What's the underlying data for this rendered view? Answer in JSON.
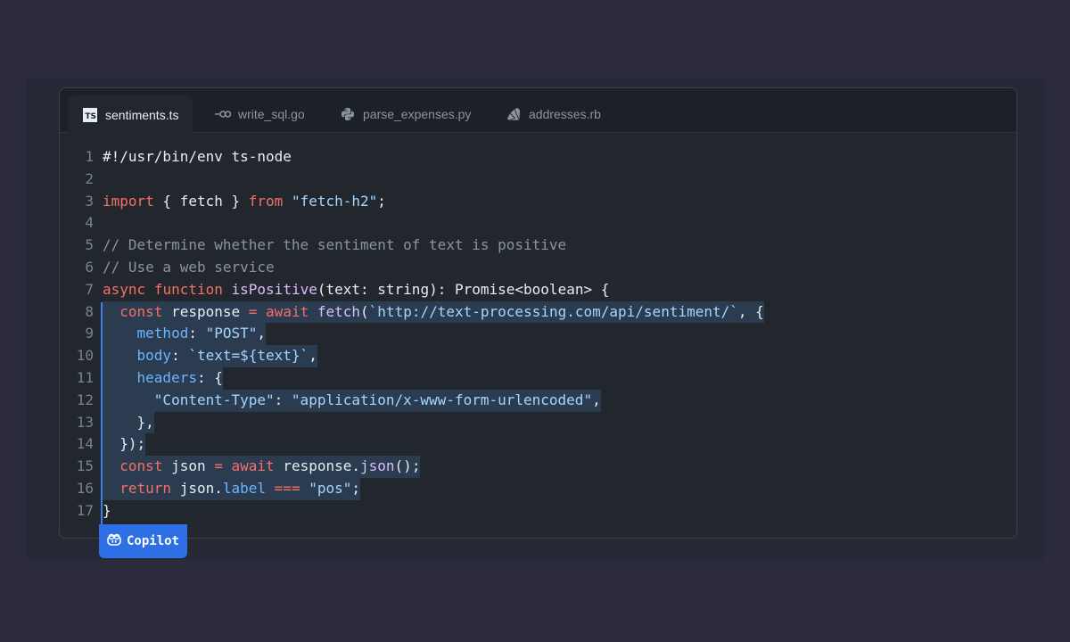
{
  "tabs": [
    {
      "label": "sentiments.ts",
      "icon": "typescript-icon",
      "active": true
    },
    {
      "label": "write_sql.go",
      "icon": "go-icon",
      "active": false
    },
    {
      "label": "parse_expenses.py",
      "icon": "python-icon",
      "active": false
    },
    {
      "label": "addresses.rb",
      "icon": "ruby-icon",
      "active": false
    }
  ],
  "ts_icon_text": "TS",
  "code_lines": [
    {
      "n": "1",
      "tokens": [
        [
          "t",
          "#!/usr/bin/env ts-node"
        ]
      ]
    },
    {
      "n": "2",
      "tokens": []
    },
    {
      "n": "3",
      "tokens": [
        [
          "kw",
          "import"
        ],
        [
          "t",
          " { fetch } "
        ],
        [
          "kw",
          "from"
        ],
        [
          "t",
          " "
        ],
        [
          "str",
          "\"fetch-h2\""
        ],
        [
          "t",
          ";"
        ]
      ]
    },
    {
      "n": "4",
      "tokens": []
    },
    {
      "n": "5",
      "tokens": [
        [
          "cm",
          "// Determine whether the sentiment of text is positive"
        ]
      ]
    },
    {
      "n": "6",
      "tokens": [
        [
          "cm",
          "// Use a web service"
        ]
      ]
    },
    {
      "n": "7",
      "tokens": [
        [
          "kw",
          "async"
        ],
        [
          "t",
          " "
        ],
        [
          "kw",
          "function"
        ],
        [
          "t",
          " "
        ],
        [
          "fn",
          "isPositive"
        ],
        [
          "t",
          "(text: string): Promise<boolean> {"
        ]
      ]
    },
    {
      "n": "8",
      "hl": true,
      "tokens": [
        [
          "t",
          "  "
        ],
        [
          "kw",
          "const"
        ],
        [
          "t",
          " response "
        ],
        [
          "op",
          "="
        ],
        [
          "t",
          " "
        ],
        [
          "kw",
          "await"
        ],
        [
          "t",
          " "
        ],
        [
          "fn",
          "fetch"
        ],
        [
          "t",
          "("
        ],
        [
          "str",
          "`http://text-processing.com/api/sentiment/`"
        ],
        [
          "t",
          ", {"
        ]
      ]
    },
    {
      "n": "9",
      "hl": true,
      "tokens": [
        [
          "t",
          "    "
        ],
        [
          "prop",
          "method"
        ],
        [
          "t",
          ": "
        ],
        [
          "str",
          "\"POST\""
        ],
        [
          "t",
          ","
        ]
      ]
    },
    {
      "n": "10",
      "hl": true,
      "tokens": [
        [
          "t",
          "    "
        ],
        [
          "prop",
          "body"
        ],
        [
          "t",
          ": "
        ],
        [
          "str",
          "`text=${text}`"
        ],
        [
          "t",
          ","
        ]
      ]
    },
    {
      "n": "11",
      "hl": true,
      "tokens": [
        [
          "t",
          "    "
        ],
        [
          "prop",
          "headers"
        ],
        [
          "t",
          ": {"
        ]
      ]
    },
    {
      "n": "12",
      "hl": true,
      "tokens": [
        [
          "t",
          "      "
        ],
        [
          "str",
          "\"Content-Type\""
        ],
        [
          "t",
          ": "
        ],
        [
          "str",
          "\"application/x-www-form-urlencoded\""
        ],
        [
          "t",
          ","
        ]
      ]
    },
    {
      "n": "13",
      "hl": true,
      "tokens": [
        [
          "t",
          "    },"
        ]
      ]
    },
    {
      "n": "14",
      "hl": true,
      "tokens": [
        [
          "t",
          "  });"
        ]
      ]
    },
    {
      "n": "15",
      "hl": true,
      "tokens": [
        [
          "t",
          "  "
        ],
        [
          "kw",
          "const"
        ],
        [
          "t",
          " json "
        ],
        [
          "op",
          "="
        ],
        [
          "t",
          " "
        ],
        [
          "kw",
          "await"
        ],
        [
          "t",
          " response."
        ],
        [
          "fn",
          "json"
        ],
        [
          "t",
          "();"
        ]
      ]
    },
    {
      "n": "16",
      "hl": true,
      "tokens": [
        [
          "t",
          "  "
        ],
        [
          "kw",
          "return"
        ],
        [
          "t",
          " json."
        ],
        [
          "prop",
          "label"
        ],
        [
          "t",
          " "
        ],
        [
          "op",
          "==="
        ],
        [
          "t",
          " "
        ],
        [
          "str",
          "\"pos\""
        ],
        [
          "t",
          ";"
        ]
      ]
    },
    {
      "n": "17",
      "tokens": [
        [
          "t",
          "}"
        ]
      ]
    }
  ],
  "copilot_label": "Copilot",
  "colors": {
    "background": "#2b2b3d",
    "editor": "#22272e",
    "keyword": "#f47067",
    "string": "#a5d6ff",
    "function": "#dcbdfb",
    "property": "#6cb6ff",
    "highlight": "#2b3b50",
    "copilot_button": "#2f6fe6"
  }
}
